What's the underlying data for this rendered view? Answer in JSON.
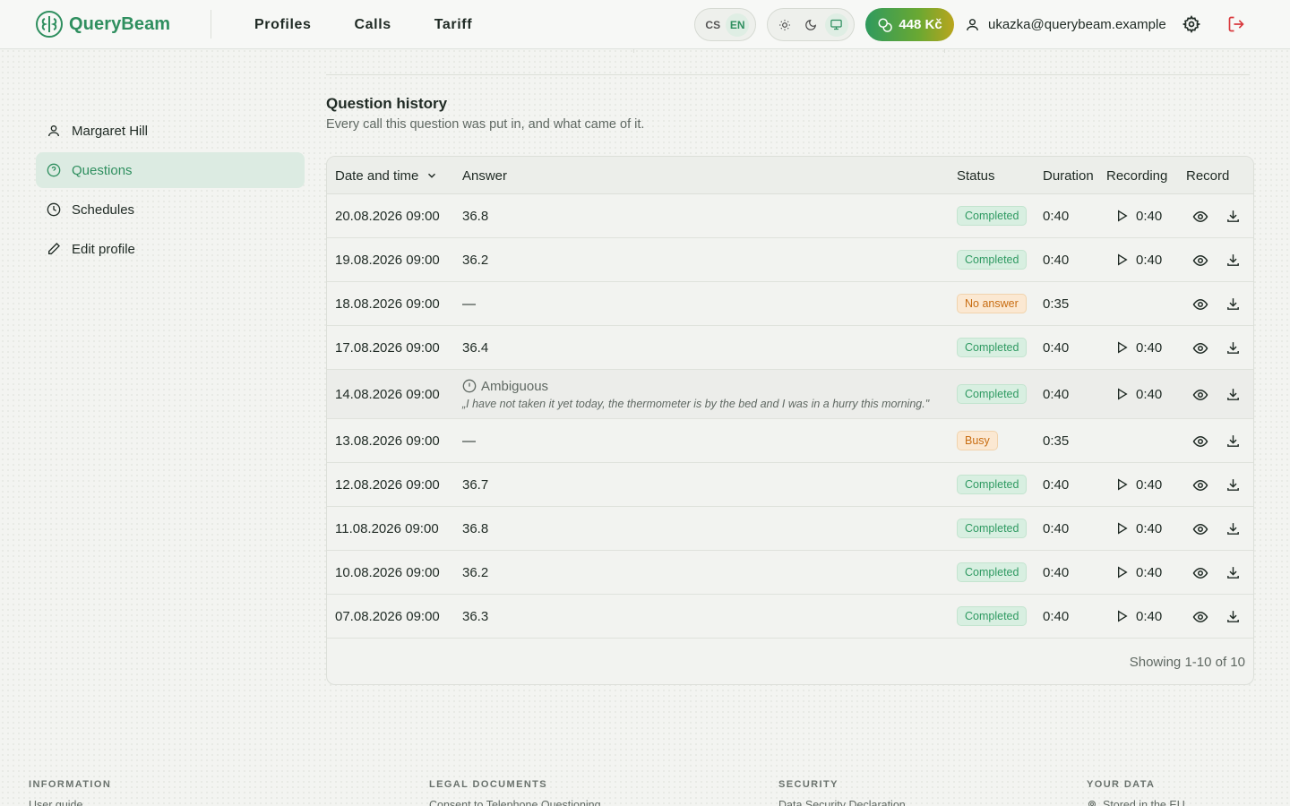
{
  "brand": {
    "name": "QueryBeam"
  },
  "nav": {
    "items": [
      "Profiles",
      "Calls",
      "Tariff"
    ]
  },
  "lang": {
    "options": [
      "CS",
      "EN"
    ],
    "active": "EN"
  },
  "credit": {
    "amount": "448 Kč"
  },
  "user": {
    "email": "ukazka@querybeam.example"
  },
  "sidebar": {
    "items": [
      {
        "label": "Margaret Hill",
        "icon": "user-icon"
      },
      {
        "label": "Questions",
        "icon": "question-circle-icon",
        "active": true
      },
      {
        "label": "Schedules",
        "icon": "clock-icon"
      },
      {
        "label": "Edit profile",
        "icon": "pencil-icon"
      }
    ]
  },
  "history": {
    "title": "Question history",
    "subtitle": "Every call this question was put in, and what came of it.",
    "columns": {
      "date": "Date and time",
      "answer": "Answer",
      "status": "Status",
      "duration": "Duration",
      "recording": "Recording",
      "record": "Record"
    },
    "rows": [
      {
        "date": "20.08.2026 09:00",
        "answer": "36.8",
        "status": "Completed",
        "duration": "0:40",
        "recording": "0:40"
      },
      {
        "date": "19.08.2026 09:00",
        "answer": "36.2",
        "status": "Completed",
        "duration": "0:40",
        "recording": "0:40"
      },
      {
        "date": "18.08.2026 09:00",
        "answer": "—",
        "status": "No answer",
        "duration": "0:35",
        "recording": ""
      },
      {
        "date": "17.08.2026 09:00",
        "answer": "36.4",
        "status": "Completed",
        "duration": "0:40",
        "recording": "0:40"
      },
      {
        "date": "14.08.2026 09:00",
        "answer": "Ambiguous",
        "quote": "„I have not taken it yet today, the thermometer is by the bed and I was in a hurry this morning.\"",
        "status": "Completed",
        "duration": "0:40",
        "recording": "0:40"
      },
      {
        "date": "13.08.2026 09:00",
        "answer": "—",
        "status": "Busy",
        "duration": "0:35",
        "recording": ""
      },
      {
        "date": "12.08.2026 09:00",
        "answer": "36.7",
        "status": "Completed",
        "duration": "0:40",
        "recording": "0:40"
      },
      {
        "date": "11.08.2026 09:00",
        "answer": "36.8",
        "status": "Completed",
        "duration": "0:40",
        "recording": "0:40"
      },
      {
        "date": "10.08.2026 09:00",
        "answer": "36.2",
        "status": "Completed",
        "duration": "0:40",
        "recording": "0:40"
      },
      {
        "date": "07.08.2026 09:00",
        "answer": "36.3",
        "status": "Completed",
        "duration": "0:40",
        "recording": "0:40"
      }
    ],
    "pagination": "Showing 1-10 of 10"
  },
  "footer": {
    "columns": [
      {
        "heading": "INFORMATION",
        "link": "User guide"
      },
      {
        "heading": "LEGAL DOCUMENTS",
        "link": "Consent to Telephone Questioning"
      },
      {
        "heading": "SECURITY",
        "link": "Data Security Declaration"
      },
      {
        "heading": "YOUR DATA",
        "link": "Stored in the EU"
      }
    ]
  },
  "colors": {
    "accent": "#2f8f5f",
    "success": "#2f9a62",
    "warning": "#c86d12",
    "logout": "#d9393d"
  }
}
